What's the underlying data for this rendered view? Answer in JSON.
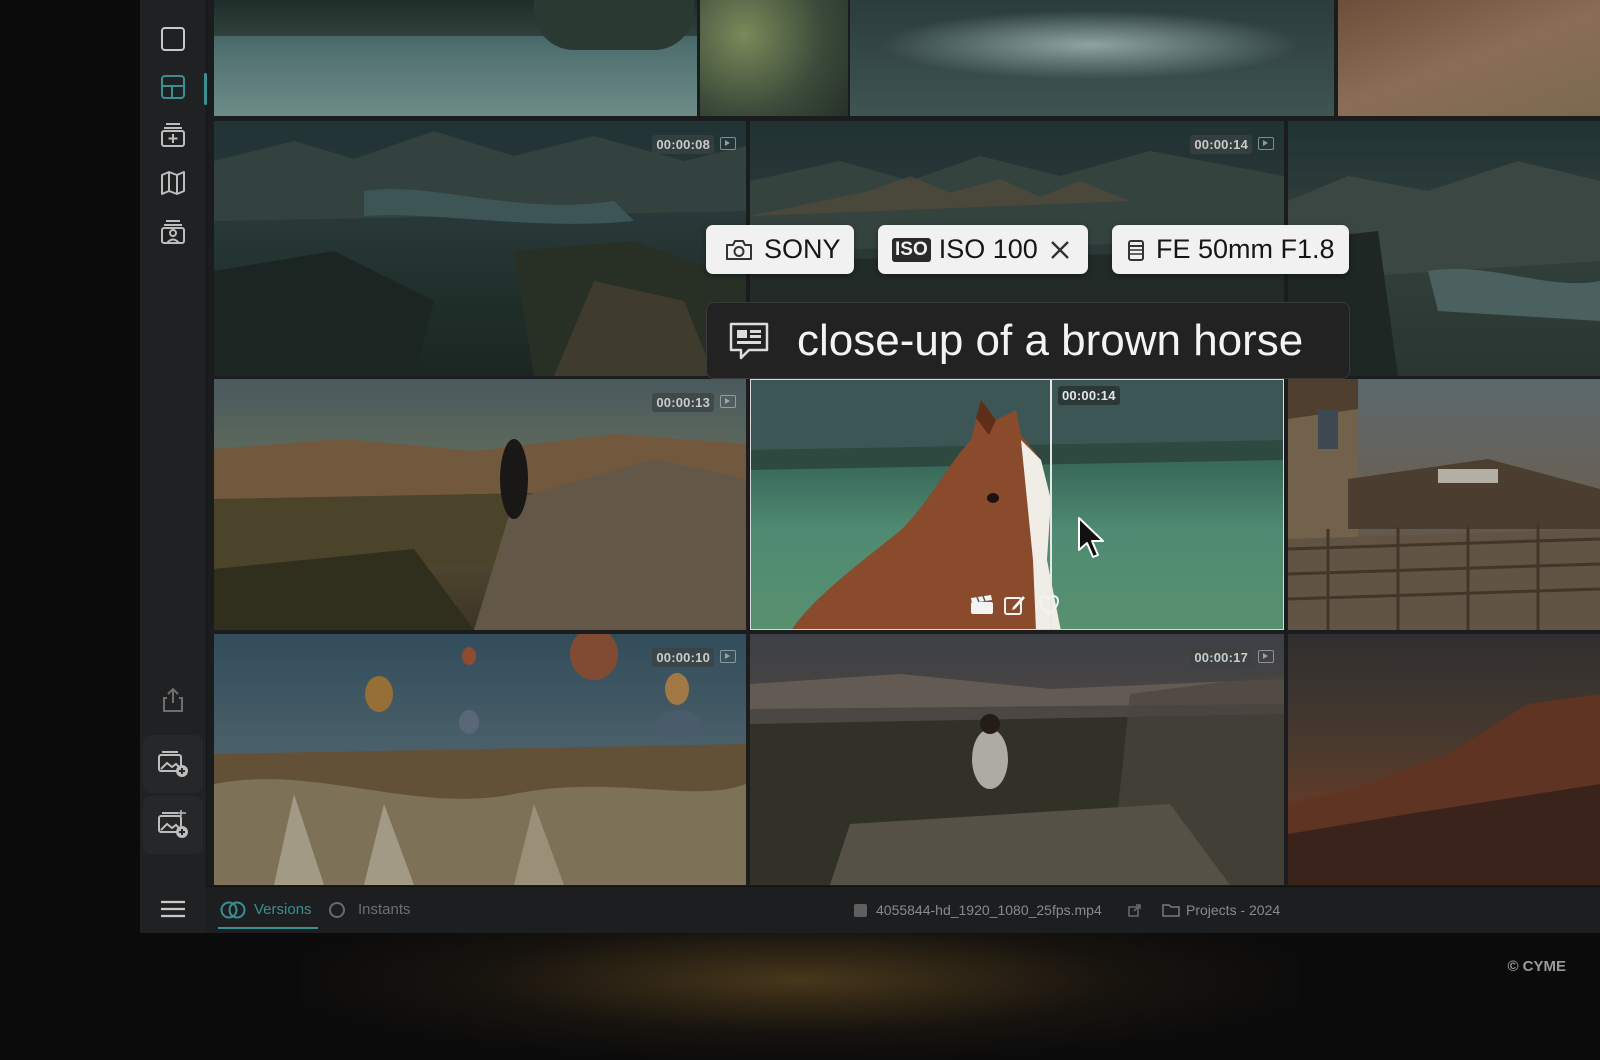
{
  "sidebar": {
    "items": [
      {
        "name": "single-view-icon"
      },
      {
        "name": "grid-view-icon"
      },
      {
        "name": "add-collection-icon"
      },
      {
        "name": "map-icon"
      },
      {
        "name": "people-icon"
      }
    ],
    "bottom": [
      {
        "name": "share-icon"
      },
      {
        "name": "add-photos-icon"
      },
      {
        "name": "import-media-icon"
      },
      {
        "name": "menu-icon"
      }
    ]
  },
  "tiles": {
    "t_canyon_river": {
      "time": "00:00:08"
    },
    "t_canyon_wide": {
      "time": "00:00:14"
    },
    "t_cliff_woman": {
      "time": "00:00:13"
    },
    "t_horse": {
      "time": "00:00:14"
    },
    "t_balloons": {
      "time": "00:00:10"
    },
    "t_sitting": {
      "time": "00:00:17"
    }
  },
  "chips": {
    "camera": "SONY",
    "iso": "ISO 100",
    "lens": "FE 50mm F1.8"
  },
  "caption": "close-up of a brown horse",
  "status": {
    "versions": "Versions",
    "instants": "Instants",
    "filename": "4055844-hd_1920_1080_25fps.mp4",
    "folder": "Projects - 2024"
  },
  "copyright": "© CYME",
  "colors": {
    "accent": "#3a8f92",
    "chip_bg": "#f1f1f1",
    "caption_bg": "#222223"
  }
}
